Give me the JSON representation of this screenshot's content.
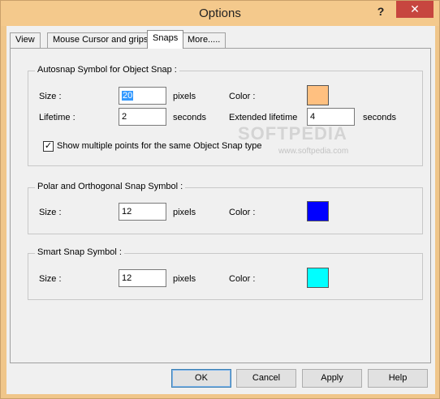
{
  "window": {
    "title": "Options",
    "help_glyph": "?",
    "close_glyph": "✕"
  },
  "tabs": [
    {
      "label": "View"
    },
    {
      "label": "Mouse Cursor and grips"
    },
    {
      "label": "Snaps"
    },
    {
      "label": "More....."
    }
  ],
  "autosnap": {
    "title": "Autosnap Symbol for Object Snap :",
    "size_label": "Size :",
    "size_value": "20",
    "size_unit": "pixels",
    "color_label": "Color :",
    "color": "#ffc080",
    "lifetime_label": "Lifetime :",
    "lifetime_value": "2",
    "lifetime_unit": "seconds",
    "ext_label": "Extended lifetime",
    "ext_value": "4",
    "ext_unit": "seconds",
    "check_label": "Show multiple points for the same Object Snap type",
    "check_mark": "✓"
  },
  "polar": {
    "title": "Polar and Orthogonal Snap Symbol :",
    "size_label": "Size :",
    "size_value": "12",
    "size_unit": "pixels",
    "color_label": "Color :",
    "color": "#0000ff"
  },
  "smart": {
    "title": "Smart Snap Symbol :",
    "size_label": "Size :",
    "size_value": "12",
    "size_unit": "pixels",
    "color_label": "Color :",
    "color": "#00ffff"
  },
  "watermark": {
    "main": "SOFTPEDIA",
    "sub": "www.softpedia.com"
  },
  "buttons": {
    "ok": "OK",
    "cancel": "Cancel",
    "apply": "Apply",
    "help": "Help"
  }
}
